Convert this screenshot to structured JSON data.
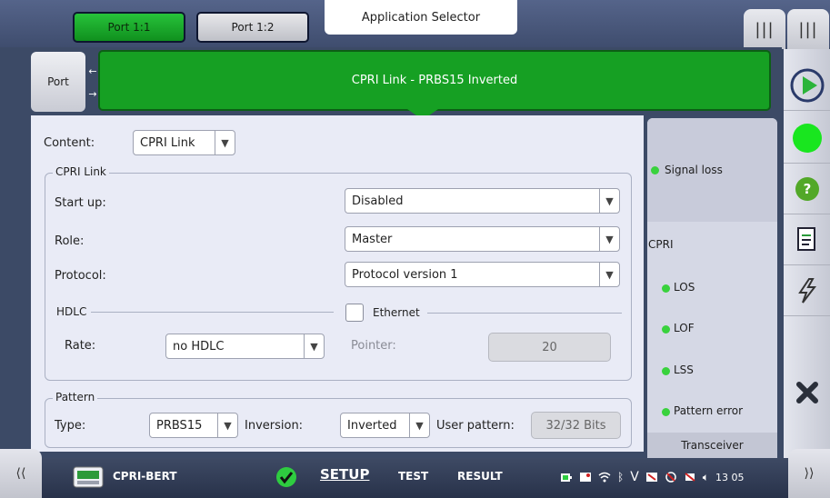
{
  "topbar": {
    "port_tabs": [
      {
        "label": "Port 1:1",
        "active": true
      },
      {
        "label": "Port 1:2",
        "active": false
      }
    ],
    "app_selector": "Application Selector",
    "menu_icon_1": "bars-icon",
    "menu_icon_2": "bars-icon"
  },
  "port_row": {
    "port_button": "Port",
    "banner": "CPRI Link - PRBS15 Inverted"
  },
  "content": {
    "content_label": "Content:",
    "content_value": "CPRI Link",
    "cpri_link": {
      "title": "CPRI Link",
      "startup_label": "Start up:",
      "startup_value": "Disabled",
      "role_label": "Role:",
      "role_value": "Master",
      "protocol_label": "Protocol:",
      "protocol_value": "Protocol version 1",
      "hdlc_label": "HDLC",
      "rate_label": "Rate:",
      "rate_value": "no HDLC",
      "ethernet_label": "Ethernet",
      "ethernet_checked": false,
      "pointer_label": "Pointer:",
      "pointer_value": "20"
    },
    "pattern": {
      "title": "Pattern",
      "type_label": "Type:",
      "type_value": "PRBS15",
      "inversion_label": "Inversion:",
      "inversion_value": "Inverted",
      "user_pattern_label": "User pattern:",
      "user_pattern_value": "32/32 Bits"
    }
  },
  "status": {
    "signal_loss": "Signal loss",
    "cpri_label": "CPRI",
    "items": [
      "LOS",
      "LOF",
      "LSS",
      "Pattern error"
    ],
    "transceiver": "Transceiver",
    "dot_color": "#39d23d"
  },
  "tools": [
    "play-icon",
    "status-led-icon",
    "help-icon",
    "report-icon",
    "lightning-icon",
    "close-icon"
  ],
  "bottombar": {
    "app_name": "CPRI-BERT",
    "setup": "SETUP",
    "test": "TEST",
    "result": "RESULT",
    "time": "13 05"
  }
}
